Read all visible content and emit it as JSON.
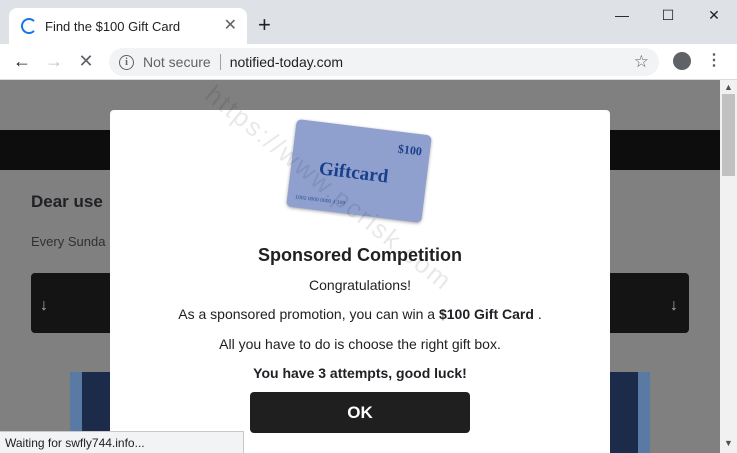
{
  "browser": {
    "tab_title": "Find the $100 Gift Card",
    "tab_close": "✕",
    "new_tab": "+",
    "window": {
      "minimize": "—",
      "maximize": "☐",
      "close": "✕"
    },
    "nav": {
      "back": "←",
      "forward": "→",
      "reload": "✕"
    },
    "security_label": "Not secure",
    "info_glyph": "i",
    "url": "notified-today.com",
    "star": "☆",
    "menu": "⋮",
    "status_text": "Waiting for swfly744.info..."
  },
  "page": {
    "heading": "Dear use",
    "subtext": "Every Sunda",
    "left_arrow": "↓",
    "right_arrow": "↓"
  },
  "scrollbar": {
    "up": "▲",
    "down": "▼"
  },
  "modal": {
    "giftcard": {
      "amount": "$100",
      "title": "Giftcard",
      "number": "1002 0000 0000 1 109"
    },
    "heading": "Sponsored Competition",
    "congrats": "Congratulations!",
    "promo_prefix": "As a sponsored promotion, you can win a",
    "promo_bold": "$100 Gift Card",
    "promo_suffix": ".",
    "instructions": "All you have to do is choose the right gift box.",
    "attempts": "You have 3 attempts, good luck!",
    "ok_label": "OK"
  },
  "watermark": "https://www.pcrisk.com"
}
